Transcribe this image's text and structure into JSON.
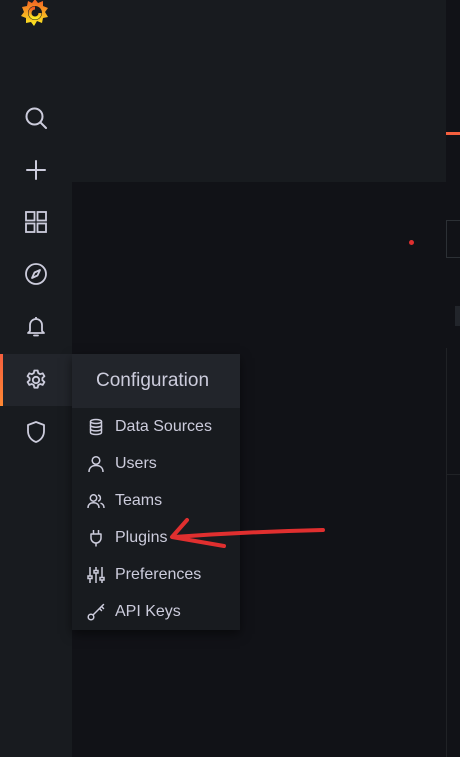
{
  "app": {
    "logo_icon": "grafana-logo-icon"
  },
  "sidenav": {
    "items": [
      {
        "name": "search",
        "icon": "search-icon"
      },
      {
        "name": "create",
        "icon": "plus-icon"
      },
      {
        "name": "dashboards",
        "icon": "dashboards-grid-icon"
      },
      {
        "name": "explore",
        "icon": "compass-icon"
      },
      {
        "name": "alerting",
        "icon": "bell-icon"
      },
      {
        "name": "configuration",
        "icon": "gear-icon",
        "active": true
      },
      {
        "name": "server-admin",
        "icon": "shield-icon"
      }
    ]
  },
  "config_menu": {
    "title": "Configuration",
    "items": [
      {
        "label": "Data Sources",
        "icon": "database-icon"
      },
      {
        "label": "Users",
        "icon": "user-icon"
      },
      {
        "label": "Teams",
        "icon": "users-icon"
      },
      {
        "label": "Plugins",
        "icon": "plug-icon"
      },
      {
        "label": "Preferences",
        "icon": "sliders-icon"
      },
      {
        "label": "API Keys",
        "icon": "key-icon"
      }
    ]
  },
  "colors": {
    "accent": "#f55f3e",
    "annotation": "#e02f2f",
    "nav_bg": "#181b1f",
    "page_bg": "#111217",
    "text": "#ccccdc"
  }
}
